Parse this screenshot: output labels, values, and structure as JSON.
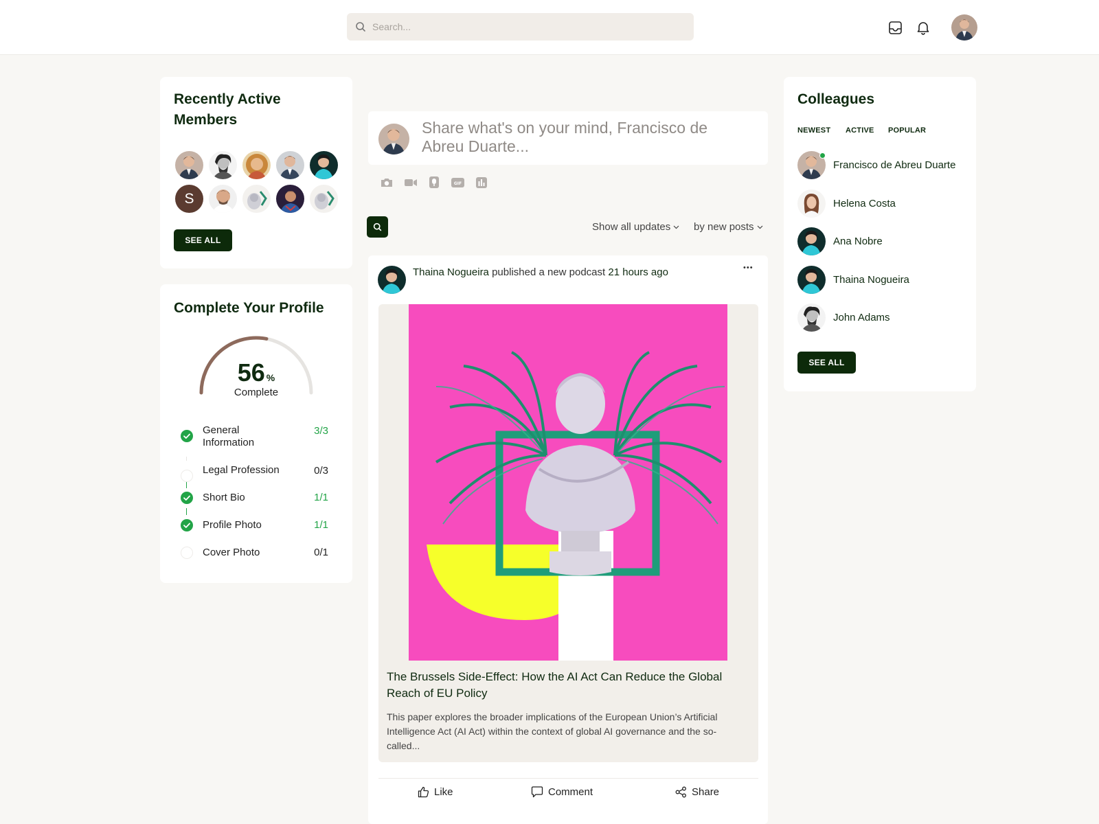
{
  "header": {
    "search_placeholder": "Search...",
    "icons": [
      "search-icon",
      "inbox-icon",
      "bell-icon"
    ]
  },
  "recent_members": {
    "title": "Recently Active Members",
    "letter_avatar": "S",
    "see_all": "SEE ALL"
  },
  "profile": {
    "title": "Complete Your Profile",
    "percent": "56",
    "percent_sign": "%",
    "percent_value": 56,
    "complete_label": "Complete",
    "items": [
      {
        "label": "General Information",
        "value": "3/3",
        "done": true
      },
      {
        "label": "Legal Profession",
        "value": "0/3",
        "done": false
      },
      {
        "label": "Short Bio",
        "value": "1/1",
        "done": true
      },
      {
        "label": "Profile Photo",
        "value": "1/1",
        "done": true
      },
      {
        "label": "Cover Photo",
        "value": "0/1",
        "done": false
      }
    ]
  },
  "composer": {
    "placeholder": "Share what's on your mind, Francisco de Abreu Duarte...",
    "tools": [
      "camera-icon",
      "video-icon",
      "microphone-icon",
      "gif-icon",
      "poll-icon"
    ]
  },
  "filters": {
    "show": "Show all updates",
    "sort": "by new posts"
  },
  "post": {
    "author": "Thaina Nogueira",
    "action": "published a new podcast",
    "time": "21 hours ago",
    "menu": "•••",
    "title": "The Brussels Side-Effect: How the AI Act Can Reduce the Global Reach of EU Policy",
    "excerpt": "This paper explores the broader implications of the European Union’s Artificial Intelligence Act (AI Act) within the context of global AI governance and the so-called...",
    "actions": {
      "like": "Like",
      "comment": "Comment",
      "share": "Share"
    }
  },
  "colleagues": {
    "title": "Colleagues",
    "tabs": [
      "NEWEST",
      "ACTIVE",
      "POPULAR"
    ],
    "people": [
      {
        "name": "Francisco de Abreu Duarte",
        "online": true
      },
      {
        "name": "Helena Costa",
        "online": false
      },
      {
        "name": "Ana Nobre",
        "online": false
      },
      {
        "name": "Thaina Nogueira",
        "online": false
      },
      {
        "name": "John Adams",
        "online": false
      }
    ],
    "see_all": "SEE ALL"
  },
  "colors": {
    "brand_dark": "#0d2a0a",
    "success": "#22a447",
    "progress": "#8d6a5c",
    "poster_pink": "#f74cbe",
    "poster_yellow": "#f6ff2a",
    "poster_green": "#1f9d7a"
  }
}
